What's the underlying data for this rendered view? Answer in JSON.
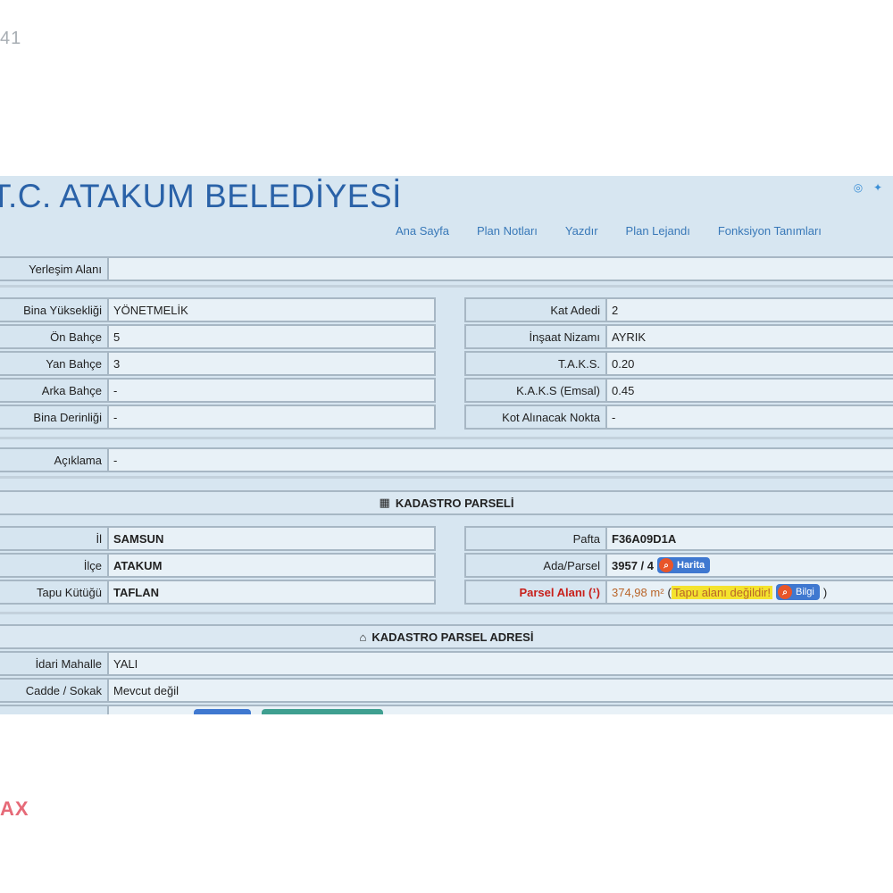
{
  "page": {
    "corner_text": "41",
    "watermark": "AX"
  },
  "header": {
    "brand": "T.C. ATAKUM BELEDİYESİ",
    "social_icons": [
      "instagram-icon",
      "twitter-icon"
    ],
    "nav": [
      "Ana Sayfa",
      "Plan Notları",
      "Yazdır",
      "Plan Lejandı",
      "Fonksiyon Tanımları"
    ]
  },
  "yerlesim": {
    "label": "Yerleşim Alanı",
    "value": ""
  },
  "left_table": [
    {
      "label": "Bina Yüksekliği",
      "value": "YÖNETMELİK"
    },
    {
      "label": "Ön Bahçe",
      "value": "5"
    },
    {
      "label": "Yan Bahçe",
      "value": "3"
    },
    {
      "label": "Arka Bahçe",
      "value": "-"
    },
    {
      "label": "Bina Derinliği",
      "value": "-"
    }
  ],
  "right_table": [
    {
      "label": "Kat Adedi",
      "value": "2"
    },
    {
      "label": "İnşaat Nizamı",
      "value": "AYRIK"
    },
    {
      "label": "T.A.K.S.",
      "value": "0.20"
    },
    {
      "label": "K.A.K.S (Emsal)",
      "value": "0.45"
    },
    {
      "label": "Kot Alınacak Nokta",
      "value": "-"
    }
  ],
  "aciklama": {
    "label": "Açıklama",
    "value": "-"
  },
  "kadastro": {
    "title": "KADASTRO PARSELİ",
    "left": [
      {
        "label": "İl",
        "value": "SAMSUN"
      },
      {
        "label": "İlçe",
        "value": "ATAKUM"
      },
      {
        "label": "Tapu Kütüğü",
        "value": "TAFLAN"
      }
    ],
    "pafta": {
      "label": "Pafta",
      "value": "F36A09D1A"
    },
    "ada_parsel": {
      "label": "Ada/Parsel",
      "value": "3957 / 4",
      "button": "Harita"
    },
    "parsel_alani": {
      "label": "Parsel Alanı (¹)",
      "value": "374,98 m²",
      "paren_open": "(",
      "note": "Tapu alanı değildir!",
      "button": "Bilgi",
      "paren_close": ")"
    }
  },
  "adres": {
    "title": "KADASTRO PARSEL ADRESİ",
    "rows": [
      {
        "label": "İdari Mahalle",
        "value": "YALI"
      },
      {
        "label": "Cadde / Sokak",
        "value": "Mevcut değil"
      }
    ]
  },
  "colors": {
    "brand": "#2a62a8",
    "nav": "#3878b8",
    "panel": "#d7e6f1",
    "button": "#3f78d0",
    "button_icon": "#e8552a",
    "warning_label": "#c8201b",
    "highlight": "#f4e32e"
  }
}
